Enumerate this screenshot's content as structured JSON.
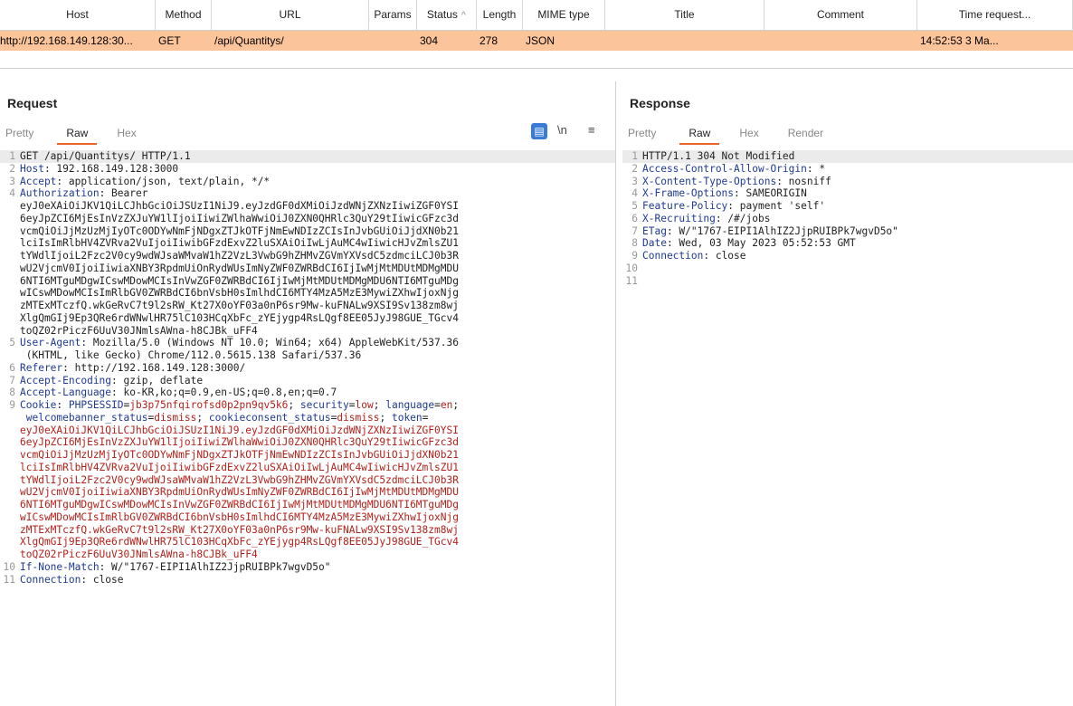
{
  "history": {
    "columns": [
      "Host",
      "Method",
      "URL",
      "Params",
      "Status",
      "Length",
      "MIME type",
      "Title",
      "Comment",
      "Time request..."
    ],
    "row": {
      "host": "http://192.168.149.128:30...",
      "method": "GET",
      "url": "/api/Quantitys/",
      "params": "",
      "status": "304",
      "length": "278",
      "mime": "JSON",
      "title": "",
      "comment": "",
      "time": "14:52:53 3 Ma..."
    },
    "sort_icon": "chevron-up-icon"
  },
  "request": {
    "title": "Request",
    "tabs": [
      "Pretty",
      "Raw",
      "Hex"
    ],
    "active_tab": "Raw",
    "toolbar": {
      "wrap_icon": "≡",
      "newline": "\\n",
      "menu": "≡"
    },
    "lines": [
      {
        "n": "1",
        "t": "GET /api/Quantitys/ HTTP/1.1"
      },
      {
        "n": "2",
        "k": "Host",
        "v": ": 192.168.149.128:3000"
      },
      {
        "n": "3",
        "k": "Accept",
        "v": ": application/json, text/plain, */*"
      },
      {
        "n": "4",
        "k": "Authorization",
        "v": ": Bearer"
      },
      {
        "n": "",
        "t": "eyJ0eXAiOiJKV1QiLCJhbGciOiJSUzI1NiJ9.eyJzdGF0dXMiOiJzdWNjZXNzIiwiZGF0YSI"
      },
      {
        "n": "",
        "t": "6eyJpZCI6MjEsInVzZXJuYW1lIjoiIiwiZWlhaWwiOiJ0ZXN0QHRlc3QuY29tIiwicGFzc3d"
      },
      {
        "n": "",
        "t": "vcmQiOiJjMzUzMjIyOTc0ODYwNmFjNDgxZTJkOTFjNmEwNDIzZCIsInJvbGUiOiJjdXN0b21"
      },
      {
        "n": "",
        "t": "lciIsImRlbHV4ZVRva2VuIjoiIiwibGFzdExvZ2luSXAiOiIwLjAuMC4wIiwicHJvZmlsZU1"
      },
      {
        "n": "",
        "t": "tYWdlIjoiL2Fzc2V0cy9wdWJsaWMvaW1hZ2VzL3VwbG9hZHMvZGVmYXVsdC5zdmciLCJ0b3R"
      },
      {
        "n": "",
        "t": "wU2VjcmV0IjoiIiwiaXNBY3RpdmUiOnRydWUsImNyZWF0ZWRBdCI6IjIwMjMtMDUtMDMgMDU"
      },
      {
        "n": "",
        "t": "6NTI6MTguMDgwICswMDowMCIsInVwZGF0ZWRBdCI6IjIwMjMtMDUtMDMgMDU6NTI6MTguMDg"
      },
      {
        "n": "",
        "t": "wICswMDowMCIsImRlbGV0ZWRBdCI6bnVsbH0sImlhdCI6MTY4MzA5MzE3MywiZXhwIjoxNjg"
      },
      {
        "n": "",
        "t": "zMTExMTczfQ.wkGeRvC7t9l2sRW_Kt27X0oYF03a0nP6sr9Mw-kuFNALw9XSI9Sv138zm8wj"
      },
      {
        "n": "",
        "t": "XlgQmGIj9Ep3QRe6rdWNwlHR75lC103HCqXbFc_zYEjygp4RsLQgf8EE05JyJ98GUE_TGcv4"
      },
      {
        "n": "",
        "t": "toQZ02rPiczF6UuV30JNmlsAWna-h8CJBk_uFF4"
      },
      {
        "n": "5",
        "k": "User-Agent",
        "v": ": Mozilla/5.0 (Windows NT 10.0; Win64; x64) AppleWebKit/537.36"
      },
      {
        "n": "",
        "t": " (KHTML, like Gecko) Chrome/112.0.5615.138 Safari/537.36"
      },
      {
        "n": "6",
        "k": "Referer",
        "v": ": http://192.168.149.128:3000/"
      },
      {
        "n": "7",
        "k": "Accept-Encoding",
        "v": ": gzip, deflate"
      },
      {
        "n": "8",
        "k": "Accept-Language",
        "v": ": ko-KR,ko;q=0.9,en-US;q=0.8,en;q=0.7"
      }
    ],
    "cookie_header": "Cookie",
    "cookie_lines": [
      [
        {
          "c": "k",
          "t": "Cookie"
        },
        {
          "c": "p",
          "t": ": "
        },
        {
          "c": "k",
          "t": "PHPSESSID"
        },
        {
          "c": "p",
          "t": "="
        },
        {
          "c": "v",
          "t": "jb3p75nfqirofsd0p2pn9qv5k6"
        },
        {
          "c": "p",
          "t": "; "
        },
        {
          "c": "k",
          "t": "security"
        },
        {
          "c": "p",
          "t": "="
        },
        {
          "c": "v",
          "t": "low"
        },
        {
          "c": "p",
          "t": "; "
        },
        {
          "c": "k",
          "t": "language"
        },
        {
          "c": "p",
          "t": "="
        },
        {
          "c": "v",
          "t": "en"
        },
        {
          "c": "p",
          "t": ";"
        }
      ],
      [
        {
          "c": "p",
          "t": " "
        },
        {
          "c": "k",
          "t": "welcomebanner_status"
        },
        {
          "c": "p",
          "t": "="
        },
        {
          "c": "v",
          "t": "dismiss"
        },
        {
          "c": "p",
          "t": "; "
        },
        {
          "c": "k",
          "t": "cookieconsent_status"
        },
        {
          "c": "p",
          "t": "="
        },
        {
          "c": "v",
          "t": "dismiss"
        },
        {
          "c": "p",
          "t": "; "
        },
        {
          "c": "k",
          "t": "token"
        },
        {
          "c": "p",
          "t": "="
        }
      ]
    ],
    "cookie_token": [
      "eyJ0eXAiOiJKV1QiLCJhbGciOiJSUzI1NiJ9.eyJzdGF0dXMiOiJzdWNjZXNzIiwiZGF0YSI",
      "6eyJpZCI6MjEsInVzZXJuYW1lIjoiIiwiZWlhaWwiOiJ0ZXN0QHRlc3QuY29tIiwicGFzc3d",
      "vcmQiOiJjMzUzMjIyOTc0ODYwNmFjNDgxZTJkOTFjNmEwNDIzZCIsInJvbGUiOiJjdXN0b21",
      "lciIsImRlbHV4ZVRva2VuIjoiIiwibGFzdExvZ2luSXAiOiIwLjAuMC4wIiwicHJvZmlsZU1",
      "tYWdlIjoiL2Fzc2V0cy9wdWJsaWMvaW1hZ2VzL3VwbG9hZHMvZGVmYXVsdC5zdmciLCJ0b3R",
      "wU2VjcmV0IjoiIiwiaXNBY3RpdmUiOnRydWUsImNyZWF0ZWRBdCI6IjIwMjMtMDUtMDMgMDU",
      "6NTI6MTguMDgwICswMDowMCIsInVwZGF0ZWRBdCI6IjIwMjMtMDUtMDMgMDU6NTI6MTguMDg",
      "wICswMDowMCIsImRlbGV0ZWRBdCI6bnVsbH0sImlhdCI6MTY4MzA5MzE3MywiZXhwIjoxNjg",
      "zMTExMTczfQ.wkGeRvC7t9l2sRW_Kt27X0oYF03a0nP6sr9Mw-kuFNALw9XSI9Sv138zm8wj",
      "XlgQmGIj9Ep3QRe6rdWNwlHR75lC103HCqXbFc_zYEjygp4RsLQgf8EE05JyJ98GUE_TGcv4",
      "toQZ02rPiczF6UuV30JNmlsAWna-h8CJBk_uFF4"
    ],
    "tail": [
      {
        "n": "10",
        "k": "If-None-Match",
        "v": ": W/\"1767-EIPI1AlhIZ2JjpRUIBPk7wgvD5o\""
      },
      {
        "n": "11",
        "k": "Connection",
        "v": ": close"
      }
    ]
  },
  "response": {
    "title": "Response",
    "tabs": [
      "Pretty",
      "Raw",
      "Hex",
      "Render"
    ],
    "active_tab": "Raw",
    "lines": [
      {
        "n": "1",
        "t": "HTTP/1.1 304 Not Modified"
      },
      {
        "n": "2",
        "k": "Access-Control-Allow-Origin",
        "v": ": *"
      },
      {
        "n": "3",
        "k": "X-Content-Type-Options",
        "v": ": nosniff"
      },
      {
        "n": "4",
        "k": "X-Frame-Options",
        "v": ": SAMEORIGIN"
      },
      {
        "n": "5",
        "k": "Feature-Policy",
        "v": ": payment 'self'"
      },
      {
        "n": "6",
        "k": "X-Recruiting",
        "v": ": /#/jobs"
      },
      {
        "n": "7",
        "k": "ETag",
        "v": ": W/\"1767-EIPI1AlhIZ2JjpRUIBPk7wgvD5o\""
      },
      {
        "n": "8",
        "k": "Date",
        "v": ": Wed, 03 May 2023 05:52:53 GMT"
      },
      {
        "n": "9",
        "k": "Connection",
        "v": ": close"
      },
      {
        "n": "10",
        "t": ""
      },
      {
        "n": "11",
        "t": ""
      }
    ]
  },
  "colors": {
    "selected_row": "#fbc49a",
    "tab_underline": "#e8642c",
    "header_key": "#1f3a93",
    "cookie_value": "#b3221b"
  }
}
